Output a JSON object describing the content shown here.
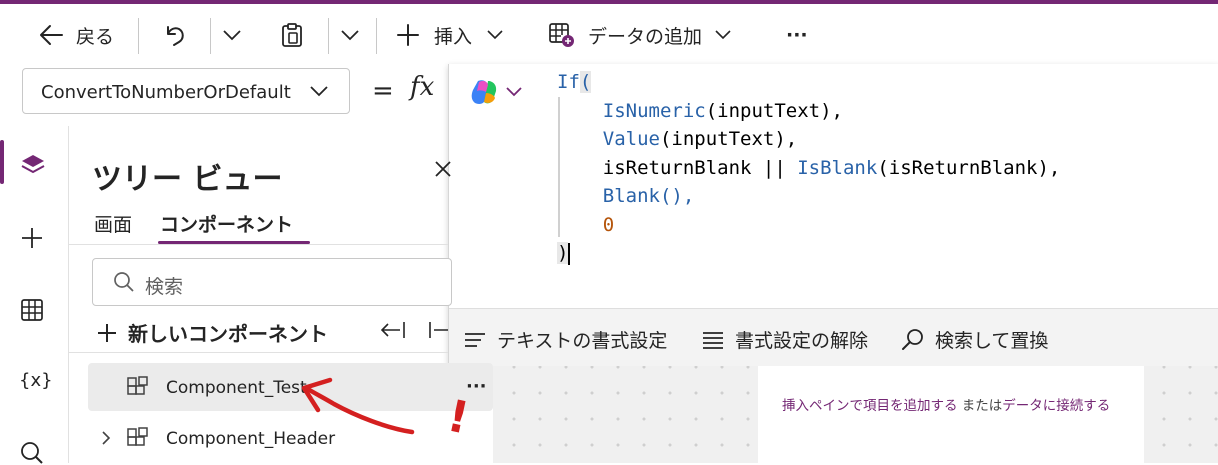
{
  "toolbar": {
    "back_label": "戻る",
    "insert_label": "挿入",
    "add_data_label": "データの追加",
    "more_label": "···"
  },
  "formula_bar": {
    "property": "ConvertToNumberOrDefault",
    "equals": "=",
    "fx": "fx",
    "code": {
      "line1_fn": "If",
      "line1_paren": "(",
      "line2_fn": "IsNumeric",
      "line2_rest": "(inputText),",
      "line3_fn": "Value",
      "line3_rest": "(inputText),",
      "line4_a": "isReturnBlank || ",
      "line4_fn": "IsBlank",
      "line4_rest": "(isReturnBlank),",
      "line5_fn": "Blank",
      "line5_rest": "(),",
      "line6_num": "0",
      "line7": ")"
    }
  },
  "format_bar": {
    "format_text": "テキストの書式設定",
    "remove_format": "書式設定の解除",
    "find_replace": "検索して置換"
  },
  "tree": {
    "title": "ツリー ビュー",
    "tabs": [
      "画面",
      "コンポーネント"
    ],
    "active_tab": "コンポーネント",
    "search_placeholder": "検索",
    "new_component": "新しいコンポーネント",
    "items": [
      {
        "label": "Component_Test",
        "selected": true
      },
      {
        "label": "Component_Header",
        "selected": false
      }
    ],
    "more_label": "···"
  },
  "canvas": {
    "hint_link1": "挿入ペインで項目を追加する",
    "hint_mid": " または",
    "hint_link2": "データに接続する"
  },
  "rail": {
    "variables_label": "{x}"
  },
  "annotation": {
    "exclaim": "!",
    "color": "#d42020"
  },
  "colors": {
    "accent": "#742774",
    "function": "#2962a8",
    "number": "#b5550b"
  }
}
